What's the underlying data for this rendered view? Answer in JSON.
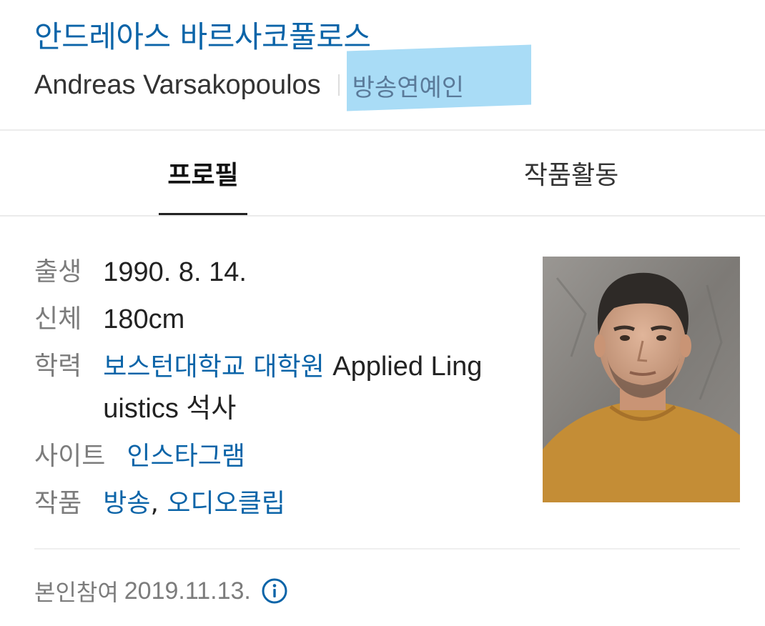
{
  "header": {
    "title_ko": "안드레아스 바르사코풀로스",
    "name_en": "Andreas Varsakopoulos",
    "occupation": "방송연예인"
  },
  "tabs": [
    {
      "label": "프로필",
      "active": true
    },
    {
      "label": "작품활동",
      "active": false
    }
  ],
  "profile": {
    "birth": {
      "label": "출생",
      "value": "1990. 8. 14."
    },
    "body": {
      "label": "신체",
      "value": "180cm"
    },
    "education": {
      "label": "학력",
      "school": "보스턴대학교 대학원",
      "major_line1": "Applied Ling",
      "major_line2": "uistics 석사"
    },
    "site": {
      "label": "사이트",
      "link": "인스타그램"
    },
    "works": {
      "label": "작품",
      "link1": "방송",
      "link2": "오디오클립"
    }
  },
  "footer": {
    "label": "본인참여",
    "date": "2019.11.13."
  },
  "colors": {
    "link": "#0b64a8",
    "highlight": "#a9dcf6",
    "label": "#7c7c7c"
  },
  "icons": {
    "info": "info-icon"
  }
}
